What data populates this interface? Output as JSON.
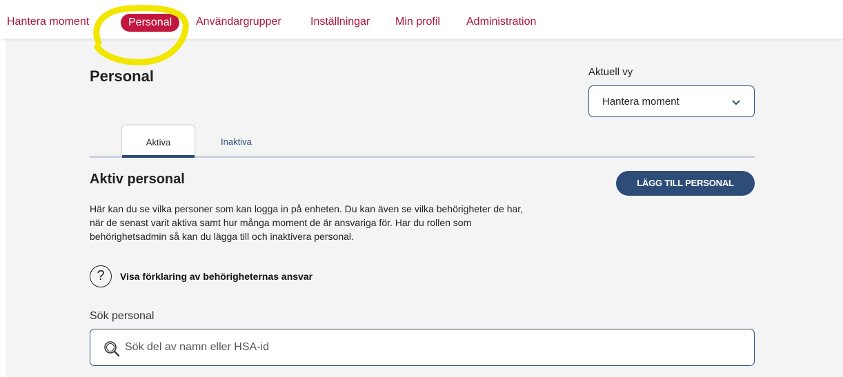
{
  "nav": {
    "items": [
      {
        "label": "Hantera moment"
      },
      {
        "label": "Personal"
      },
      {
        "label": "Användargrupper"
      },
      {
        "label": "Inställningar"
      },
      {
        "label": "Min profil"
      },
      {
        "label": "Administration"
      }
    ]
  },
  "page": {
    "title": "Personal",
    "view_label": "Aktuell vy",
    "view_value": "Hantera moment"
  },
  "tabs": [
    {
      "label": "Aktiva"
    },
    {
      "label": "Inaktiva"
    }
  ],
  "section": {
    "title": "Aktiv personal",
    "add_button": "LÄGG TILL PERSONAL",
    "description": "Här kan du se vilka personer som kan logga in på enheten. Du kan även se vilka behörigheter de har, när de senast varit aktiva samt hur många moment de är ansvariga för. Har du rollen som behörighetsadmin så kan du lägga till och inaktivera personal.",
    "help_icon_char": "?",
    "help_link": "Visa förklaring av behörigheternas ansvar"
  },
  "search": {
    "label": "Sök personal",
    "placeholder": "Sök del av namn eller HSA-id",
    "value": ""
  },
  "colors": {
    "accent": "#c2183f",
    "nav_text": "#a8163a",
    "primary": "#2d4d78",
    "highlight": "#f2e600"
  },
  "icons": [
    "chevron-down-icon",
    "question-icon",
    "search-icon"
  ]
}
